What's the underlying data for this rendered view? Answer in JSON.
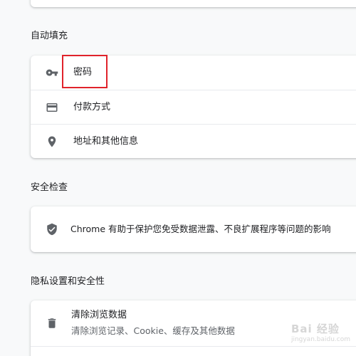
{
  "sections": {
    "autofill": {
      "title": "自动填充",
      "items": [
        {
          "label": "密码",
          "icon": "key-icon"
        },
        {
          "label": "付款方式",
          "icon": "credit-card-icon"
        },
        {
          "label": "地址和其他信息",
          "icon": "location-pin-icon"
        }
      ]
    },
    "safety_check": {
      "title": "安全检查",
      "description": "Chrome 有助于保护您免受数据泄露、不良扩展程序等问题的影响",
      "icon": "shield-check-icon"
    },
    "privacy": {
      "title": "隐私设置和安全性",
      "items": [
        {
          "label": "清除浏览数据",
          "sublabel": "清除浏览记录、Cookie、缓存及其他数据",
          "icon": "trash-icon"
        }
      ]
    }
  },
  "watermark": {
    "text": "Bai 经验",
    "sub": "jingyan.baidu.com"
  },
  "colors": {
    "background": "#f8f9fa",
    "card": "#ffffff",
    "icon": "#5f6368",
    "highlight": "#e0232b"
  }
}
